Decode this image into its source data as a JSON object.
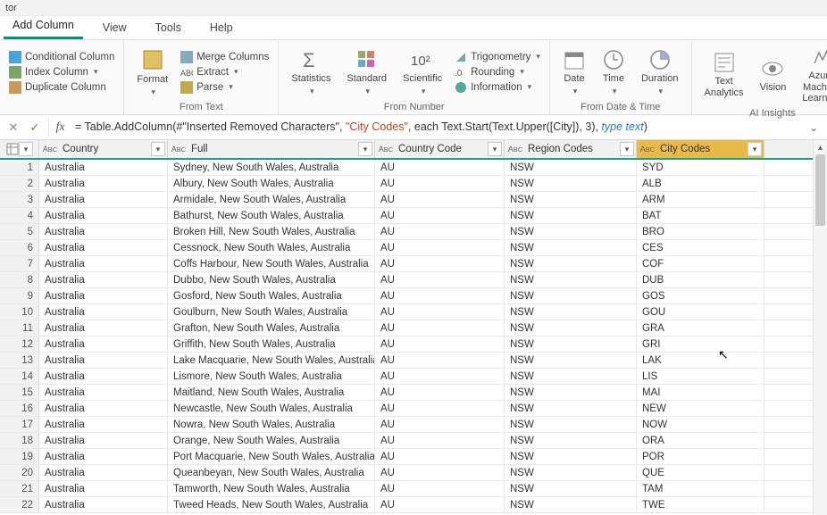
{
  "titlebar": "tor",
  "tabs": [
    "Add Column",
    "View",
    "Tools",
    "Help"
  ],
  "active_tab": 0,
  "ribbon": {
    "group1": {
      "items": [
        "Conditional Column",
        "Index Column",
        "Duplicate Column"
      ]
    },
    "from_text": {
      "title": "From Text",
      "format": "Format",
      "items": [
        "Merge Columns",
        "Extract",
        "Parse"
      ]
    },
    "from_number": {
      "title": "From Number",
      "big": [
        "Statistics",
        "Standard",
        "Scientific"
      ],
      "items": [
        "Trigonometry",
        "Rounding",
        "Information"
      ]
    },
    "from_datetime": {
      "title": "From Date & Time",
      "big": [
        "Date",
        "Time",
        "Duration"
      ]
    },
    "ai": {
      "title": "AI Insights",
      "big": [
        "Text\nAnalytics",
        "Vision",
        "Azure Machine\nLearning"
      ]
    }
  },
  "formula": {
    "prefix": "= Table.AddColumn(#\"Inserted Removed Characters\", ",
    "colname": "\"City Codes\"",
    "mid": ", each Text.Start(Text.Upper([City]), 3), ",
    "type": "type text",
    "suffix": ")"
  },
  "columns": [
    {
      "key": "country",
      "label": "Country"
    },
    {
      "key": "full",
      "label": "Full"
    },
    {
      "key": "code",
      "label": "Country Code"
    },
    {
      "key": "region",
      "label": "Region Codes"
    },
    {
      "key": "city",
      "label": "City Codes"
    }
  ],
  "selected_col": "city",
  "chart_data": {
    "type": "table",
    "columns": [
      "#",
      "Country",
      "Full",
      "Country Code",
      "Region Codes",
      "City Codes"
    ],
    "rows": [
      [
        1,
        "Australia",
        "Sydney, New South Wales, Australia",
        "AU",
        "NSW",
        "SYD"
      ],
      [
        2,
        "Australia",
        "Albury, New South Wales, Australia",
        "AU",
        "NSW",
        "ALB"
      ],
      [
        3,
        "Australia",
        "Armidale, New South Wales, Australia",
        "AU",
        "NSW",
        "ARM"
      ],
      [
        4,
        "Australia",
        "Bathurst, New South Wales, Australia",
        "AU",
        "NSW",
        "BAT"
      ],
      [
        5,
        "Australia",
        "Broken Hill, New South Wales, Australia",
        "AU",
        "NSW",
        "BRO"
      ],
      [
        6,
        "Australia",
        "Cessnock, New South Wales, Australia",
        "AU",
        "NSW",
        "CES"
      ],
      [
        7,
        "Australia",
        "Coffs Harbour, New South Wales, Australia",
        "AU",
        "NSW",
        "COF"
      ],
      [
        8,
        "Australia",
        "Dubbo, New South Wales, Australia",
        "AU",
        "NSW",
        "DUB"
      ],
      [
        9,
        "Australia",
        "Gosford, New South Wales, Australia",
        "AU",
        "NSW",
        "GOS"
      ],
      [
        10,
        "Australia",
        "Goulburn, New South Wales, Australia",
        "AU",
        "NSW",
        "GOU"
      ],
      [
        11,
        "Australia",
        "Grafton, New South Wales, Australia",
        "AU",
        "NSW",
        "GRA"
      ],
      [
        12,
        "Australia",
        "Griffith, New South Wales, Australia",
        "AU",
        "NSW",
        "GRI"
      ],
      [
        13,
        "Australia",
        "Lake Macquarie, New South Wales, Australia",
        "AU",
        "NSW",
        "LAK"
      ],
      [
        14,
        "Australia",
        "Lismore, New South Wales, Australia",
        "AU",
        "NSW",
        "LIS"
      ],
      [
        15,
        "Australia",
        "Maitland, New South Wales, Australia",
        "AU",
        "NSW",
        "MAI"
      ],
      [
        16,
        "Australia",
        "Newcastle, New South Wales, Australia",
        "AU",
        "NSW",
        "NEW"
      ],
      [
        17,
        "Australia",
        "Nowra, New South Wales, Australia",
        "AU",
        "NSW",
        "NOW"
      ],
      [
        18,
        "Australia",
        "Orange, New South Wales, Australia",
        "AU",
        "NSW",
        "ORA"
      ],
      [
        19,
        "Australia",
        "Port Macquarie, New South Wales, Australia",
        "AU",
        "NSW",
        "POR"
      ],
      [
        20,
        "Australia",
        "Queanbeyan, New South Wales, Australia",
        "AU",
        "NSW",
        "QUE"
      ],
      [
        21,
        "Australia",
        "Tamworth, New South Wales, Australia",
        "AU",
        "NSW",
        "TAM"
      ],
      [
        22,
        "Australia",
        "Tweed Heads, New South Wales, Australia",
        "AU",
        "NSW",
        "TWE"
      ]
    ]
  }
}
